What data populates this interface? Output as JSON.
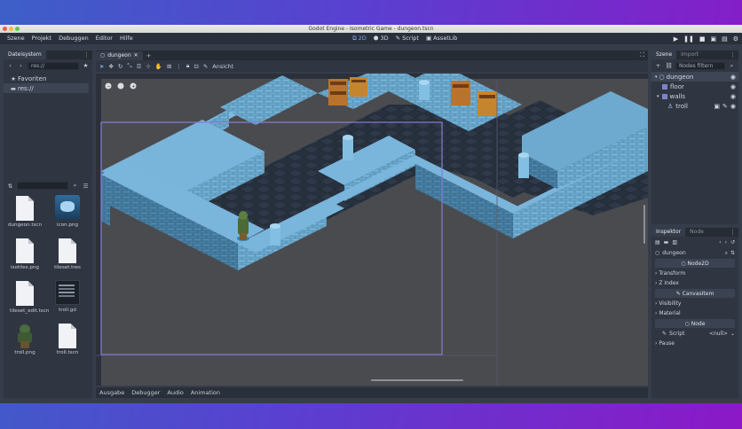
{
  "window": {
    "title": "Godot Engine - Isometric Game - dungeon.tscn"
  },
  "menu": {
    "items": [
      "Szene",
      "Projekt",
      "Debuggen",
      "Editor",
      "Hilfe"
    ]
  },
  "modes": {
    "m2d": "2D",
    "m3d": "3D",
    "script": "Script",
    "assetlib": "AssetLib"
  },
  "filesystem": {
    "tab": "Dateisystem",
    "path": "res://",
    "tree": {
      "favorites": "Favoriten",
      "root": "res://"
    },
    "files": [
      {
        "name": "dungeon.tscn",
        "icon": "scene-file-icon"
      },
      {
        "name": "icon.png",
        "icon": "image-thumb-icon"
      },
      {
        "name": "isotiles.png",
        "icon": "image-thumb-icon"
      },
      {
        "name": "tileset.tres",
        "icon": "resource-file-icon"
      },
      {
        "name": "tileset_edit.tscn",
        "icon": "scene-file-icon"
      },
      {
        "name": "troll.gd",
        "icon": "script-file-icon"
      },
      {
        "name": "troll.png",
        "icon": "troll-thumb-icon"
      },
      {
        "name": "troll.tscn",
        "icon": "scene-file-icon"
      }
    ]
  },
  "editor": {
    "scene_tab": "dungeon",
    "view_label": "Ansicht"
  },
  "bottom": {
    "tabs": [
      "Ausgabe",
      "Debugger",
      "Audio",
      "Animation"
    ]
  },
  "scene": {
    "tabs": [
      "Szene",
      "Import"
    ],
    "filter_placeholder": "Nodes filtern",
    "nodes": [
      {
        "name": "dungeon",
        "level": 0
      },
      {
        "name": "floor",
        "level": 1
      },
      {
        "name": "walls",
        "level": 1
      },
      {
        "name": "troll",
        "level": 2
      }
    ]
  },
  "inspector": {
    "tabs": [
      "Inspektor",
      "Node"
    ],
    "object": "dungeon",
    "class_node2d": "Node2D",
    "transform": "Transform",
    "zindex": "Z Index",
    "class_canvasitem": "CanvasItem",
    "visibility": "Visibility",
    "material": "Material",
    "class_node": "Node",
    "script_label": "Script",
    "script_value": "<null>",
    "pause": "Pause"
  },
  "colors": {
    "accent": "#74a7f0",
    "wall": "#5a97bc",
    "floor": "#27303d",
    "background": "#4a4b4f"
  }
}
